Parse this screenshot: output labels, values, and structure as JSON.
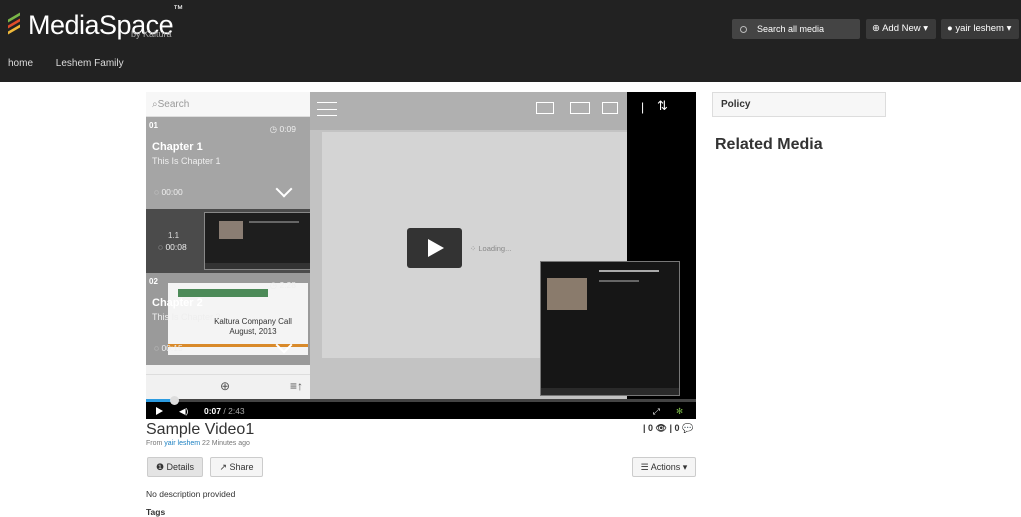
{
  "header": {
    "logo_text": "MediaSpace",
    "logo_tm": "™",
    "logo_sub": "by Kaltura",
    "nav": [
      "home",
      "Leshem Family"
    ],
    "search_placeholder": "Search all media",
    "add_new_label": "Add New",
    "user_label": "yair leshem",
    "logo_colors": [
      "#7ab648",
      "#e14d2a",
      "#f0b93a"
    ]
  },
  "player": {
    "search_placeholder": "Search",
    "chapters": [
      {
        "num": "01",
        "time": "0:09",
        "title": "Chapter 1",
        "desc": "This Is Chapter 1",
        "start": "00:00"
      },
      {
        "num": "02",
        "time": "2:28",
        "title": "Chapter 2",
        "desc": "This Is Chapter 2",
        "start": "00:15"
      }
    ],
    "subchapter": {
      "num": "1.1",
      "time": "00:08"
    },
    "slide_text": "Kaltura Company Call August, 2013",
    "loading_text": "Loading...",
    "current_time": "0:07",
    "total_time": "/ 2:43",
    "progress": 0.05
  },
  "sidebar": {
    "policy": "Policy",
    "related_media": "Related Media"
  },
  "media": {
    "title": "Sample Video1",
    "from_prefix": "From",
    "author": "yair leshem",
    "ago": "22 Minutes ago",
    "stats": "| 0 👁 | 0 💬",
    "details_label": "Details",
    "share_label": "Share",
    "actions_label": "Actions ▾",
    "description": "No description provided",
    "tags_label": "Tags"
  }
}
